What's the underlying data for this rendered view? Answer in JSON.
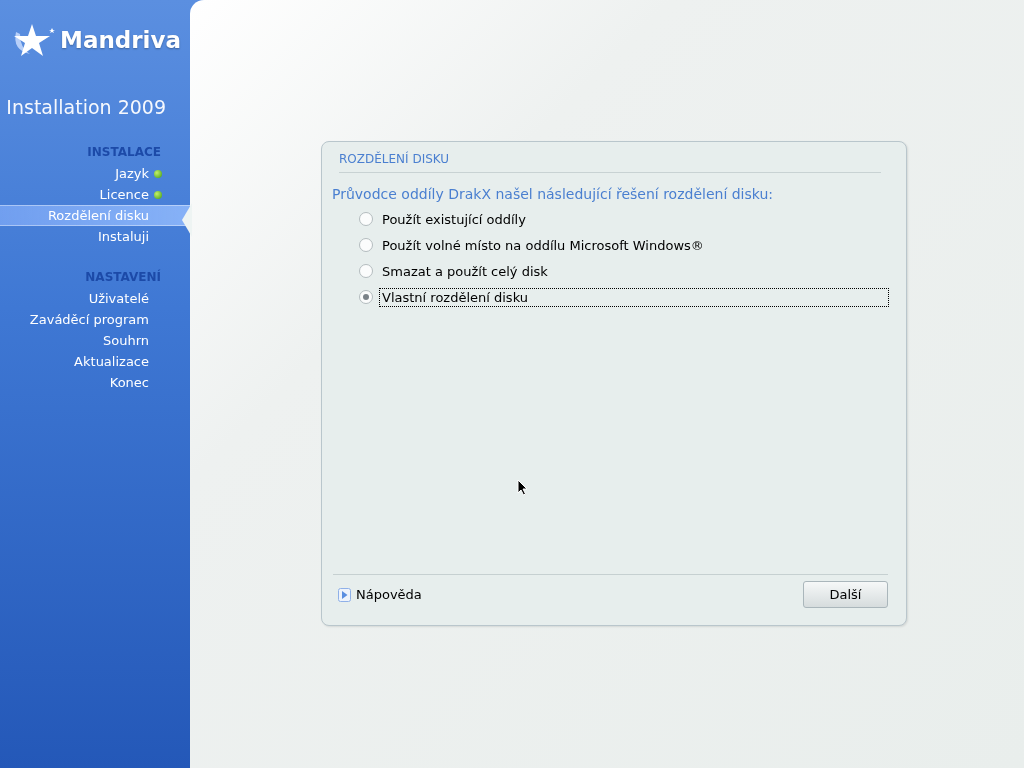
{
  "sidebar": {
    "logo": {
      "name": "Mandriva",
      "subtitle": "Installation 2009"
    },
    "sections": [
      {
        "title": "INSTALACE",
        "items": [
          {
            "label": "Jazyk",
            "done": true,
            "selected": false
          },
          {
            "label": "Licence",
            "done": true,
            "selected": false
          },
          {
            "label": "Rozdělení disku",
            "done": false,
            "selected": true
          },
          {
            "label": "Instaluji",
            "done": false,
            "selected": false
          }
        ]
      },
      {
        "title": "NASTAVENÍ",
        "items": [
          {
            "label": "Uživatelé",
            "done": false,
            "selected": false
          },
          {
            "label": "Zaváděcí program",
            "done": false,
            "selected": false
          },
          {
            "label": "Souhrn",
            "done": false,
            "selected": false
          },
          {
            "label": "Aktualizace",
            "done": false,
            "selected": false
          },
          {
            "label": "Konec",
            "done": false,
            "selected": false
          }
        ]
      }
    ]
  },
  "dialog": {
    "title": "ROZDĚLENÍ DISKU",
    "prompt": "Průvodce oddíly DrakX našel následující řešení rozdělení disku:",
    "options": [
      {
        "label": "Použít existující oddíly",
        "selected": false
      },
      {
        "label": "Použít volné místo na oddílu Microsoft Windows®",
        "selected": false
      },
      {
        "label": "Smazat a použít celý disk",
        "selected": false
      },
      {
        "label": "Vlastní rozdělení disku",
        "selected": true
      }
    ],
    "help": "Nápověda",
    "next_button": "Další"
  }
}
